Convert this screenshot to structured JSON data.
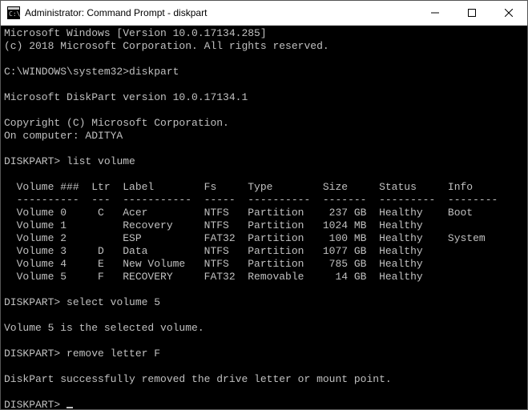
{
  "titlebar": {
    "title": "Administrator: Command Prompt - diskpart"
  },
  "banner": {
    "line1": "Microsoft Windows [Version 10.0.17134.285]",
    "line2": "(c) 2018 Microsoft Corporation. All rights reserved."
  },
  "lines": {
    "prompt1": "C:\\WINDOWS\\system32>",
    "cmd1": "diskpart",
    "dpVersion": "Microsoft DiskPart version 10.0.17134.1",
    "copyright": "Copyright (C) Microsoft Corporation.",
    "onComputer": "On computer: ADITYA",
    "dpPrompt": "DISKPART>",
    "cmd2": "list volume",
    "cmd3": "select volume 5",
    "result3": "Volume 5 is the selected volume.",
    "cmd4": "remove letter F",
    "result4": "DiskPart successfully removed the drive letter or mount point."
  },
  "table": {
    "headers": {
      "volume": "Volume ###",
      "ltr": "Ltr",
      "label": "Label",
      "fs": "Fs",
      "type": "Type",
      "size": "Size",
      "status": "Status",
      "info": "Info"
    },
    "dashes": {
      "volume": "----------",
      "ltr": "---",
      "label": "-----------",
      "fs": "-----",
      "type": "----------",
      "size": "-------",
      "status": "---------",
      "info": "--------"
    },
    "rows": [
      {
        "vol": "Volume 0",
        "ltr": "C",
        "label": "Acer",
        "fs": "NTFS",
        "type": "Partition",
        "size": "237 GB",
        "status": "Healthy",
        "info": "Boot"
      },
      {
        "vol": "Volume 1",
        "ltr": "",
        "label": "Recovery",
        "fs": "NTFS",
        "type": "Partition",
        "size": "1024 MB",
        "status": "Healthy",
        "info": ""
      },
      {
        "vol": "Volume 2",
        "ltr": "",
        "label": "ESP",
        "fs": "FAT32",
        "type": "Partition",
        "size": "100 MB",
        "status": "Healthy",
        "info": "System"
      },
      {
        "vol": "Volume 3",
        "ltr": "D",
        "label": "Data",
        "fs": "NTFS",
        "type": "Partition",
        "size": "1077 GB",
        "status": "Healthy",
        "info": ""
      },
      {
        "vol": "Volume 4",
        "ltr": "E",
        "label": "New Volume",
        "fs": "NTFS",
        "type": "Partition",
        "size": "785 GB",
        "status": "Healthy",
        "info": ""
      },
      {
        "vol": "Volume 5",
        "ltr": "F",
        "label": "RECOVERY",
        "fs": "FAT32",
        "type": "Removable",
        "size": "14 GB",
        "status": "Healthy",
        "info": ""
      }
    ]
  }
}
